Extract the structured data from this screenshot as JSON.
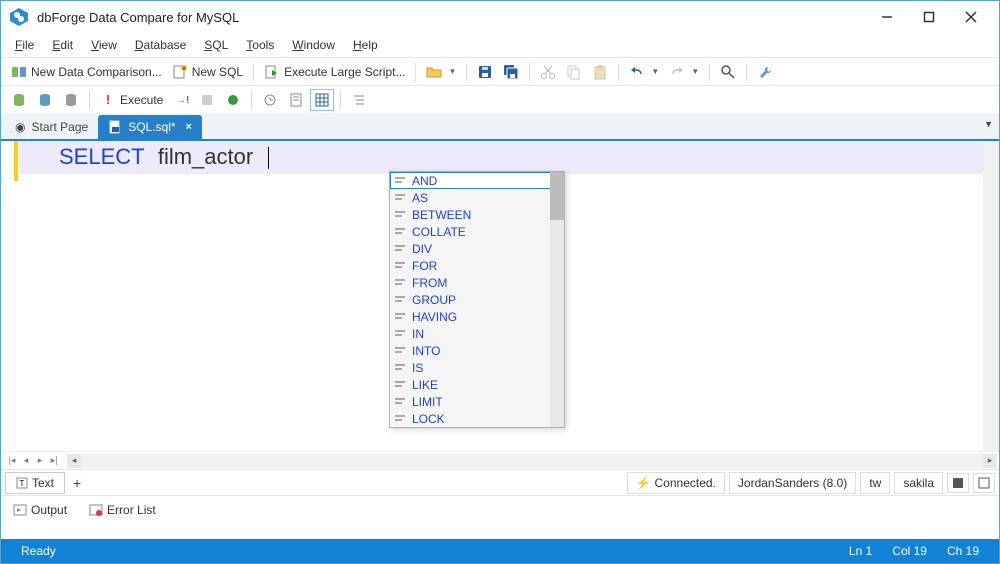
{
  "app": {
    "title": "dbForge Data Compare for MySQL"
  },
  "menubar": [
    {
      "label": "File",
      "u": 0
    },
    {
      "label": "Edit",
      "u": 0
    },
    {
      "label": "View",
      "u": 0
    },
    {
      "label": "Database",
      "u": 0
    },
    {
      "label": "SQL",
      "u": 0
    },
    {
      "label": "Tools",
      "u": 0
    },
    {
      "label": "Window",
      "u": 0
    },
    {
      "label": "Help",
      "u": 0
    }
  ],
  "toolbar1": {
    "new_comparison": "New Data Comparison...",
    "new_sql": "New SQL",
    "exec_large": "Execute Large Script..."
  },
  "toolbar2": {
    "execute": "Execute"
  },
  "tabs": {
    "start": "Start Page",
    "sql": "SQL.sql*"
  },
  "editor": {
    "keyword": "SELECT",
    "identifier": "film_actor"
  },
  "autocomplete": {
    "items": [
      "AND",
      "AS",
      "BETWEEN",
      "COLLATE",
      "DIV",
      "FOR",
      "FROM",
      "GROUP",
      "HAVING",
      "IN",
      "INTO",
      "IS",
      "LIKE",
      "LIMIT",
      "LOCK"
    ],
    "selected_index": 0
  },
  "bottom_tabs": {
    "text": "Text"
  },
  "conn": {
    "status": "Connected.",
    "server": "JordanSanders (8.0)",
    "user": "tw",
    "db": "sakila"
  },
  "panels": {
    "output": "Output",
    "errors": "Error List"
  },
  "statusbar": {
    "ready": "Ready",
    "ln": "Ln 1",
    "col": "Col 19",
    "ch": "Ch 19"
  }
}
